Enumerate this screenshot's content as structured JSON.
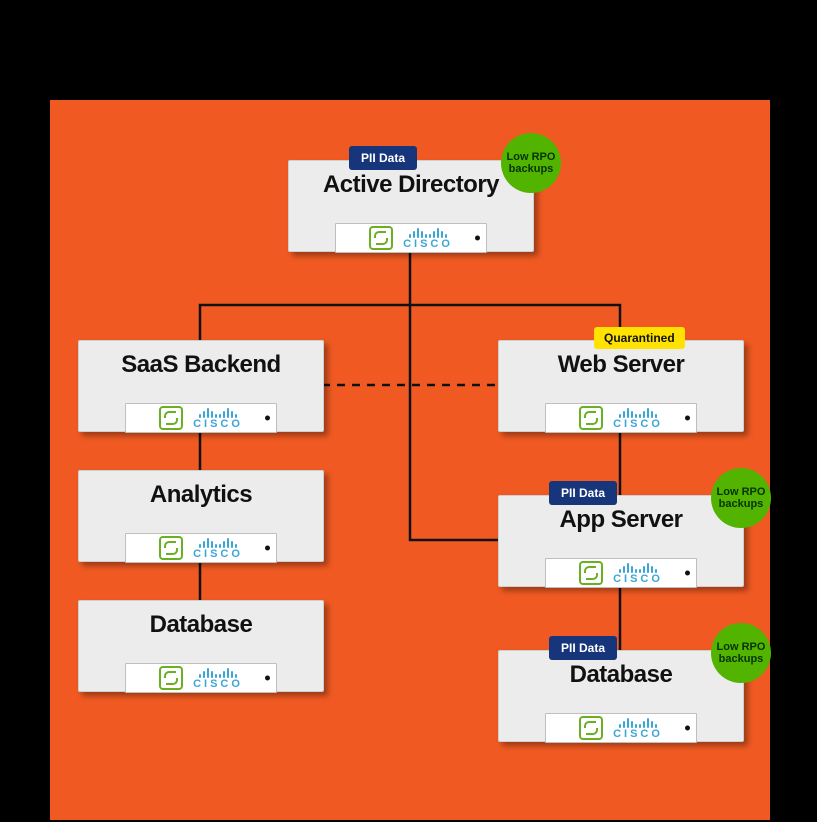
{
  "badges": {
    "pii": "PII Data",
    "quarantined": "Quarantined",
    "low_rpo": "Low RPO backups"
  },
  "vendors": {
    "cohesity_icon": "cohesity-s-mark",
    "cisco_label": "CISCO"
  },
  "nodes": {
    "ad": {
      "title": "Active Directory",
      "pii": true,
      "low_rpo": true,
      "quarantined": false
    },
    "saas": {
      "title": "SaaS Backend",
      "pii": false,
      "low_rpo": false,
      "quarantined": false
    },
    "web": {
      "title": "Web Server",
      "pii": false,
      "low_rpo": false,
      "quarantined": true
    },
    "analytics": {
      "title": "Analytics",
      "pii": false,
      "low_rpo": false,
      "quarantined": false
    },
    "app": {
      "title": "App Server",
      "pii": true,
      "low_rpo": true,
      "quarantined": false
    },
    "db_left": {
      "title": "Database",
      "pii": false,
      "low_rpo": false,
      "quarantined": false
    },
    "db_right": {
      "title": "Database",
      "pii": true,
      "low_rpo": true,
      "quarantined": false
    }
  },
  "edges": [
    {
      "from": "ad",
      "to": "saas",
      "style": "solid"
    },
    {
      "from": "ad",
      "to": "app",
      "style": "solid"
    },
    {
      "from": "ad",
      "to": "web",
      "style": "solid"
    },
    {
      "from": "saas",
      "to": "web",
      "style": "dashed"
    },
    {
      "from": "saas",
      "to": "analytics",
      "style": "solid"
    },
    {
      "from": "analytics",
      "to": "db_left",
      "style": "solid"
    },
    {
      "from": "web",
      "to": "app",
      "style": "solid"
    },
    {
      "from": "app",
      "to": "db_right",
      "style": "solid"
    }
  ],
  "colors": {
    "canvas": "#f05a22",
    "node_bg": "#ececec",
    "pii_bg": "#17357a",
    "quarantine_bg": "#ffe200",
    "rpo_bg": "#52b400",
    "cisco": "#3aa6d6",
    "cohesity": "#6ab023"
  }
}
